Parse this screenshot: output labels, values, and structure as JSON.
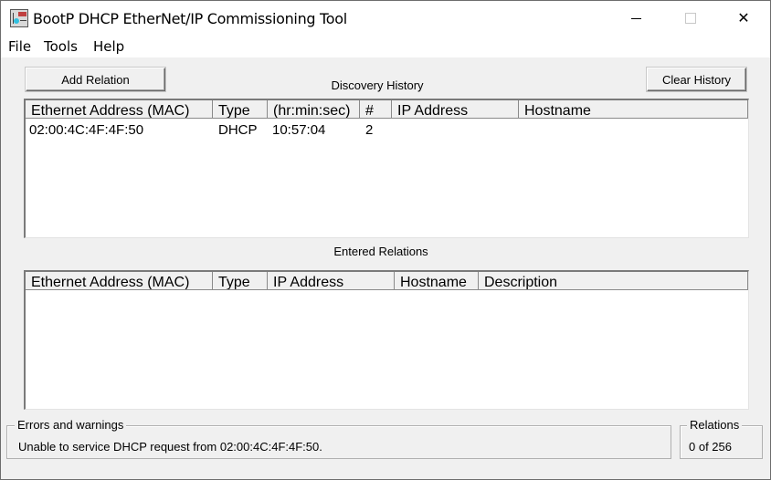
{
  "window": {
    "title": "BootP DHCP EtherNet/IP Commissioning Tool",
    "controls": {
      "minimize": "minimize",
      "maximize": "maximize",
      "close": "✕"
    }
  },
  "menu": [
    "File",
    "Tools",
    "Help"
  ],
  "toolbar": {
    "add_relation": "Add Relation",
    "clear_history": "Clear History"
  },
  "discovery": {
    "title": "Discovery History",
    "columns": [
      "Ethernet Address (MAC)",
      "Type",
      "(hr:min:sec)",
      "#",
      "IP Address",
      "Hostname"
    ],
    "rows": [
      [
        "02:00:4C:4F:4F:50",
        "DHCP",
        "10:57:04",
        "2",
        "",
        ""
      ]
    ]
  },
  "relations": {
    "title": "Entered Relations",
    "columns": [
      "Ethernet Address (MAC)",
      "Type",
      "IP Address",
      "Hostname",
      "Description"
    ],
    "rows": []
  },
  "status": {
    "errors_title": "Errors and warnings",
    "errors_text": "Unable to service DHCP request from 02:00:4C:4F:4F:50.",
    "relations_title": "Relations",
    "relations_text": "0 of 256"
  }
}
